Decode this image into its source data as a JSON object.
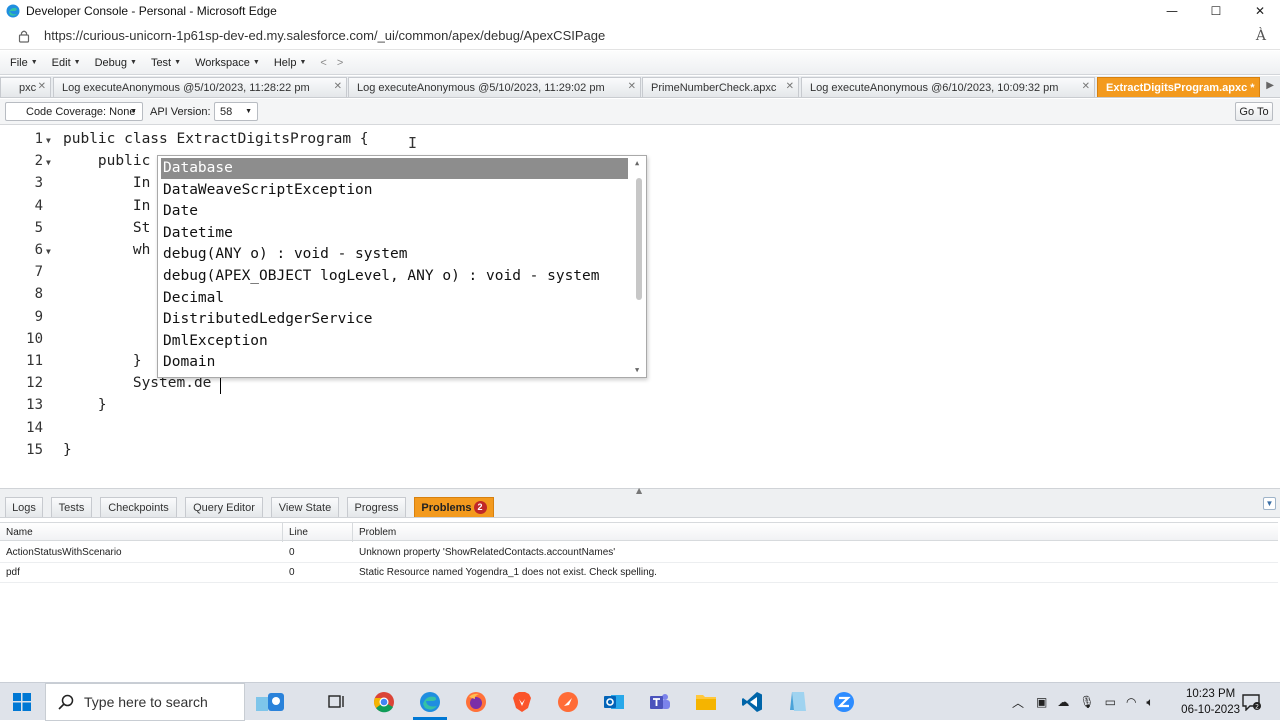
{
  "window": {
    "title": "Developer Console - Personal - Microsoft Edge",
    "minimize": "—",
    "maximize": "☐",
    "close": "✕"
  },
  "address": {
    "url": "https://curious-unicorn-1p61sp-dev-ed.my.salesforce.com/_ui/common/apex/debug/ApexCSIPage",
    "read_aloud": "À"
  },
  "menu": {
    "items": [
      {
        "label": "File"
      },
      {
        "label": "Edit"
      },
      {
        "label": "Debug"
      },
      {
        "label": "Test"
      },
      {
        "label": "Workspace"
      },
      {
        "label": "Help"
      }
    ],
    "back": "<",
    "forward": ">"
  },
  "tabs": [
    {
      "label": "pxc"
    },
    {
      "label": "Log executeAnonymous @5/10/2023, 11:28:22 pm"
    },
    {
      "label": "Log executeAnonymous @5/10/2023, 11:29:02 pm"
    },
    {
      "label": "PrimeNumberCheck.apxc"
    },
    {
      "label": "Log executeAnonymous @6/10/2023, 10:09:32 pm"
    },
    {
      "label": "ExtractDigitsProgram.apxc *"
    }
  ],
  "toolbar": {
    "coverage": "Code Coverage: None",
    "api_label": "API Version:",
    "api_value": "58",
    "goto": "Go To"
  },
  "editor": {
    "lines": [
      {
        "num": "1",
        "text": "public class ExtractDigitsProgram {"
      },
      {
        "num": "2",
        "text": "    public"
      },
      {
        "num": "3",
        "text": "        In"
      },
      {
        "num": "4",
        "text": "        In"
      },
      {
        "num": "5",
        "text": "        St"
      },
      {
        "num": "6",
        "text": "        wh"
      },
      {
        "num": "7",
        "text": ""
      },
      {
        "num": "8",
        "text": ""
      },
      {
        "num": "9",
        "text": ""
      },
      {
        "num": "10",
        "text": ""
      },
      {
        "num": "11",
        "text": "        }"
      },
      {
        "num": "12",
        "text": "        System.de"
      },
      {
        "num": "13",
        "text": "    }"
      },
      {
        "num": "14",
        "text": ""
      },
      {
        "num": "15",
        "text": "}"
      }
    ]
  },
  "autocomplete": {
    "items": [
      "Database",
      "DataWeaveScriptException",
      "Date",
      "Datetime",
      "debug(ANY o) : void - system",
      "debug(APEX_OBJECT logLevel, ANY o) : void - system",
      "Decimal",
      "DistributedLedgerService",
      "DmlException",
      "Domain"
    ],
    "selected": "Database"
  },
  "panel": {
    "tabs": [
      {
        "label": "Logs"
      },
      {
        "label": "Tests"
      },
      {
        "label": "Checkpoints"
      },
      {
        "label": "Query Editor"
      },
      {
        "label": "View State"
      },
      {
        "label": "Progress"
      },
      {
        "label": "Problems"
      }
    ],
    "problems_count": "2",
    "columns": [
      "Name",
      "Line",
      "Problem"
    ],
    "rows": [
      {
        "name": "ActionStatusWithScenario",
        "line": "0",
        "problem": "Unknown property 'ShowRelatedContacts.accountNames'"
      },
      {
        "name": "pdf",
        "line": "0",
        "problem": "Static Resource named Yogendra_1 does not exist. Check spelling."
      }
    ]
  },
  "taskbar": {
    "search_placeholder": "Type here to search",
    "time": "10:23 PM",
    "date": "06-10-2023"
  },
  "colors": {
    "active_tab": "#f39a1e",
    "selection": "#8d8d8d",
    "badge": "#c02828"
  }
}
